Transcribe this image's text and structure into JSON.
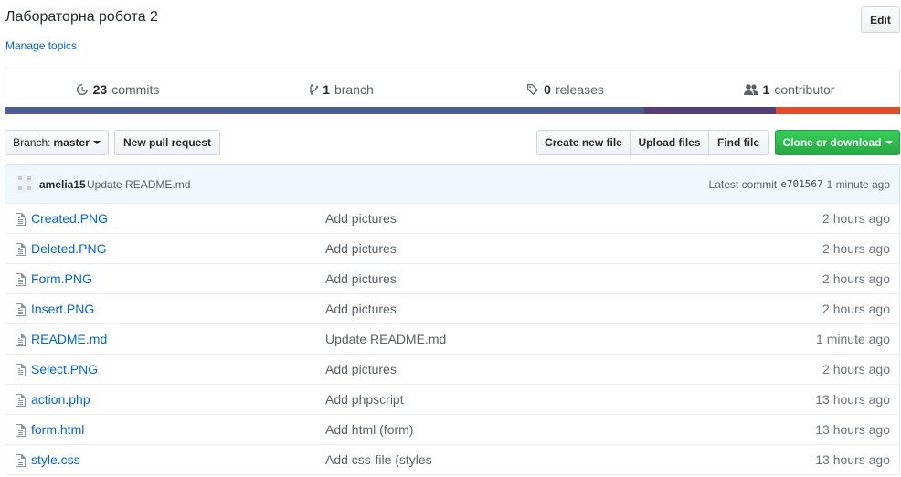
{
  "repo": {
    "title": "Лабораторна робота 2",
    "manage_topics": "Manage topics",
    "edit_label": "Edit"
  },
  "summary": {
    "commits": {
      "count": "23",
      "label": "commits"
    },
    "branches": {
      "count": "1",
      "label": "branch"
    },
    "releases": {
      "count": "0",
      "label": "releases"
    },
    "contributors": {
      "count": "1",
      "label": "contributor"
    }
  },
  "language_bar": [
    {
      "color": "#4F5D95",
      "percent": 71.4
    },
    {
      "color": "#563d7c",
      "percent": 14.7
    },
    {
      "color": "#e34c26",
      "percent": 13.9
    }
  ],
  "toolbar": {
    "branch_prefix": "Branch:",
    "branch_name": "master",
    "new_pull_request": "New pull request",
    "create_new_file": "Create new file",
    "upload_files": "Upload files",
    "find_file": "Find file",
    "clone_or_download": "Clone or download"
  },
  "latest_commit": {
    "author": "amelia15",
    "message": "Update README.md",
    "label": "Latest commit",
    "sha": "e701567",
    "age": "1 minute ago"
  },
  "files": [
    {
      "name": "Created.PNG",
      "message": "Add pictures",
      "age": "2 hours ago"
    },
    {
      "name": "Deleted.PNG",
      "message": "Add pictures",
      "age": "2 hours ago"
    },
    {
      "name": "Form.PNG",
      "message": "Add pictures",
      "age": "2 hours ago"
    },
    {
      "name": "Insert.PNG",
      "message": "Add pictures",
      "age": "2 hours ago"
    },
    {
      "name": "README.md",
      "message": "Update README.md",
      "age": "1 minute ago"
    },
    {
      "name": "Select.PNG",
      "message": "Add pictures",
      "age": "2 hours ago"
    },
    {
      "name": "action.php",
      "message": "Add phpscript",
      "age": "13 hours ago"
    },
    {
      "name": "form.html",
      "message": "Add html (form)",
      "age": "13 hours ago"
    },
    {
      "name": "style.css",
      "message": "Add css-file (styles",
      "age": "13 hours ago"
    }
  ]
}
